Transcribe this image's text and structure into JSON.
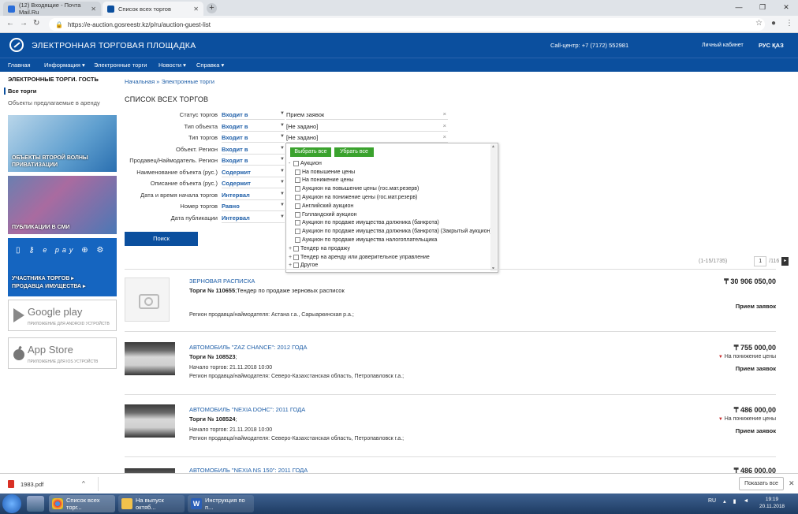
{
  "browser": {
    "tabs": [
      {
        "title": "(12) Входящие - Почта Mail.Ru",
        "active": false
      },
      {
        "title": "Список всех торгов",
        "active": true
      }
    ],
    "url": "https://e-auction.gosreestr.kz/p/ru/auction-guest-list"
  },
  "header": {
    "site_title": "ЭЛЕКТРОННАЯ ТОРГОВАЯ ПЛОЩАДКА",
    "call_center": "Call-центр: +7 (7172) 552981",
    "cabinet": "Личный кабинет",
    "langs": "РУС ҚАЗ",
    "brand_color": "#0b4f9e"
  },
  "nav": [
    "Главная",
    "Информация ▾",
    "Электронные торги",
    "Новости ▾",
    "Справка ▾"
  ],
  "sidebar": {
    "title": "ЭЛЕКТРОННЫЕ ТОРГИ. ГОСТЬ",
    "active_item": "Все торги",
    "link": "Объекты предлагаемые в аренду",
    "promo1": "ОБЪЕКТЫ ВТОРОЙ ВОЛНЫ ПРИВАТИЗАЦИИ",
    "promo2": "ПУБЛИКАЦИИ В СМИ",
    "promo3_line1": "УЧАСТНИКА ТОРГОВ ▸",
    "promo3_line2": "ПРОДАВЦА ИМУЩЕСТВА ▸",
    "epay": "e pay",
    "gplay_name": "Google play",
    "gplay_sub": "ПРИЛОЖЕНИЕ ДЛЯ ANDROID УСТРОЙСТВ",
    "appstore_name": "App Store",
    "appstore_sub": "ПРИЛОЖЕНИЕ ДЛЯ IOS УСТРОЙСТВ"
  },
  "main": {
    "breadcrumb": "Начальная » Электронные торги",
    "page_title": "СПИСОК ВСЕХ ТОРГОВ",
    "filters": [
      {
        "label": "Статус торгов",
        "op": "Входит в",
        "value": "Прием заявок",
        "clear": "×"
      },
      {
        "label": "Тип объекта",
        "op": "Входит в",
        "value": "[Не задано]",
        "clear": "×"
      },
      {
        "label": "Тип торгов",
        "op": "Входит в",
        "value": "[Не задано]",
        "clear": "×"
      },
      {
        "label": "Объект. Регион",
        "op": "Входит в",
        "value": "",
        "clear": ""
      },
      {
        "label": "Продавец/Наймодатель. Регион",
        "op": "Входит в",
        "value": "",
        "clear": ""
      },
      {
        "label": "Наименование объекта (рус.)",
        "op": "Содержит",
        "value": "",
        "clear": ""
      },
      {
        "label": "Описание объекта (рус.)",
        "op": "Содержит",
        "value": "",
        "clear": ""
      },
      {
        "label": "Дата и время начала торгов",
        "op": "Интервал",
        "value": "",
        "clear": ""
      },
      {
        "label": "Номер торгов",
        "op": "Равно",
        "value": "",
        "clear": ""
      },
      {
        "label": "Дата публикации",
        "op": "Интервал",
        "value": "",
        "clear": ""
      }
    ],
    "search_label": "Поиск",
    "dropdown": {
      "select_all": "Выбрать все",
      "clear_all": "Убрать все",
      "items": [
        {
          "label": "Аукцион",
          "toggle": "-",
          "level": 0
        },
        {
          "label": "На повышение цены",
          "toggle": "",
          "level": 1
        },
        {
          "label": "На понижение цены",
          "toggle": "",
          "level": 1
        },
        {
          "label": "Аукцион на повышение цены (гос.мат.резерв)",
          "toggle": "",
          "level": 1
        },
        {
          "label": "Аукцион на понижение цены (гос.мат.резерв)",
          "toggle": "",
          "level": 1
        },
        {
          "label": "Английский аукцион",
          "toggle": "",
          "level": 1
        },
        {
          "label": "Голландский аукцион",
          "toggle": "",
          "level": 1
        },
        {
          "label": "Аукцион по продаже имущества должника (банкрота)",
          "toggle": "",
          "level": 1
        },
        {
          "label": "Аукцион по продаже имущества должника (банкрота) (Закрытый аукцион)",
          "toggle": "",
          "level": 1
        },
        {
          "label": "Аукцион по продаже имущества налогоплательщика",
          "toggle": "",
          "level": 1
        },
        {
          "label": "Тендер на продажу",
          "toggle": "+",
          "level": 0
        },
        {
          "label": "Тендер на аренду или доверительное управление",
          "toggle": "+",
          "level": 0
        },
        {
          "label": "Другое",
          "toggle": "+",
          "level": 0
        }
      ]
    },
    "pager": {
      "range": "(1-15/1735)",
      "page": "1",
      "total": "/116",
      "next": "▸"
    },
    "lots": [
      {
        "title": "ЗЕРНОВАЯ РАСПИСКА",
        "number_label": "Торги № 110655",
        "number_rest": ";Тендер по продаже зерновых расписок",
        "start": "",
        "region": "Регион продавца/наймодателя:  Астана г.а.,  Сарыаркинская р.а.;",
        "price": "₸ 30 906 050,00",
        "type": "",
        "status": "Прием заявок",
        "thumb": "placeholder"
      },
      {
        "title": "АВТОМОБИЛЬ \"ZAZ CHANCE\": 2012 ГОДА",
        "number_label": "Торги № 108523",
        "number_rest": ";",
        "start": "Начало торгов:  21.11.2018 10:00",
        "region": "Регион продавца/наймодателя:  Северо-Казахстанская область,  Петропавловск г.а.;",
        "price": "₸ 755 000,00",
        "type": "На понижение цены",
        "status": "Прием заявок",
        "thumb": "car"
      },
      {
        "title": "АВТОМОБИЛЬ \"NEXIA DOHC\": 2011 ГОДА",
        "number_label": "Торги № 108524",
        "number_rest": ";",
        "start": "Начало торгов:  21.11.2018 10:00",
        "region": "Регион продавца/наймодателя:  Северо-Казахстанская область,  Петропавловск г.а.;",
        "price": "₸ 486 000,00",
        "type": "На понижение цены",
        "status": "Прием заявок",
        "thumb": "car"
      },
      {
        "title": "АВТОМОБИЛЬ \"NEXIA NS 150\": 2011 ГОДА",
        "price": "₸ 486 000,00"
      }
    ]
  },
  "downloads": {
    "file": "1983.pdf",
    "show_all": "Показать все"
  },
  "taskbar": {
    "tasks": [
      "Список всех торг...",
      "На выпуск октяб...",
      "Инструкция по п..."
    ],
    "lang": "RU",
    "time": "19:19",
    "date": "20.11.2018"
  }
}
